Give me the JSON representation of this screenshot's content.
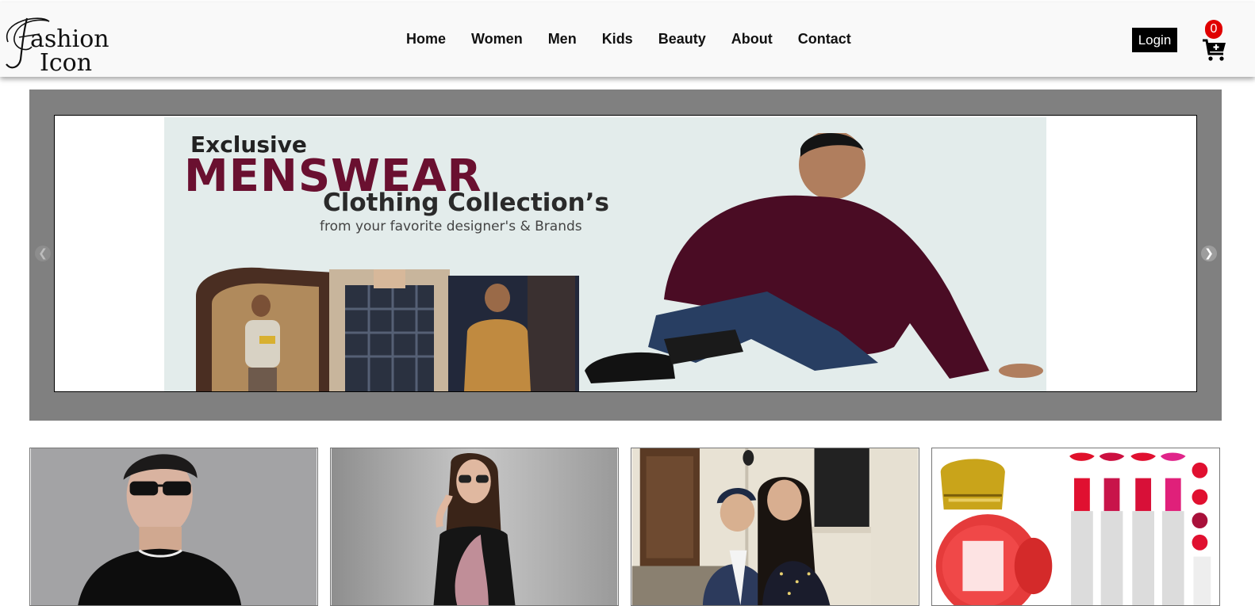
{
  "brand": {
    "logo_text": "Fashion Icon"
  },
  "nav": {
    "items": [
      "Home",
      "Women",
      "Men",
      "Kids",
      "Beauty",
      "About",
      "Contact"
    ],
    "login_label": "Login",
    "cart_count": "0"
  },
  "carousel": {
    "prev_icon": "chevron-left-icon",
    "next_icon": "chevron-right-icon",
    "slide": {
      "line1": "Exclusive",
      "line2": "MENSWEAR",
      "line3": "Clothing Collection’s",
      "line4": "from your favorite designer's & Brands"
    }
  },
  "categories": [
    "men",
    "women",
    "kids",
    "beauty"
  ],
  "colors": {
    "header_bg": "#f9f9f9",
    "carousel_bg": "#808080",
    "badge": "#e00000",
    "menswear": "#6a1030"
  }
}
